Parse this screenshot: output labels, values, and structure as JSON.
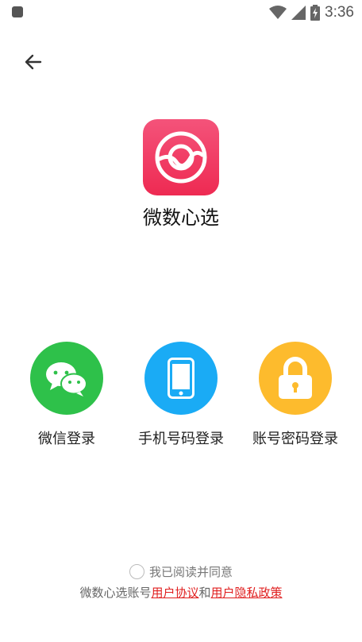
{
  "status_bar": {
    "time": "3:36",
    "icons": [
      "notification-icon",
      "wifi-icon",
      "signal-icon",
      "battery-charging-icon"
    ]
  },
  "header": {
    "back_icon": "arrow-left-icon"
  },
  "app": {
    "name": "微数心选",
    "logo_icon": "app-logo-icon",
    "logo_colors": [
      "#f4537a",
      "#ee2a52"
    ]
  },
  "login_options": [
    {
      "label": "微信登录",
      "icon": "wechat-icon",
      "color": "#2ec14a"
    },
    {
      "label": "手机号码登录",
      "icon": "phone-icon",
      "color": "#1aabf5"
    },
    {
      "label": "账号密码登录",
      "icon": "lock-icon",
      "color": "#fdbb2d"
    }
  ],
  "agreement": {
    "checked": false,
    "check_label": "我已阅读并同意",
    "prefix": "微数心选账号",
    "user_agreement": "用户协议",
    "conjunction": "和",
    "privacy_policy": "用户隐私政策",
    "link_color": "#e02020"
  }
}
